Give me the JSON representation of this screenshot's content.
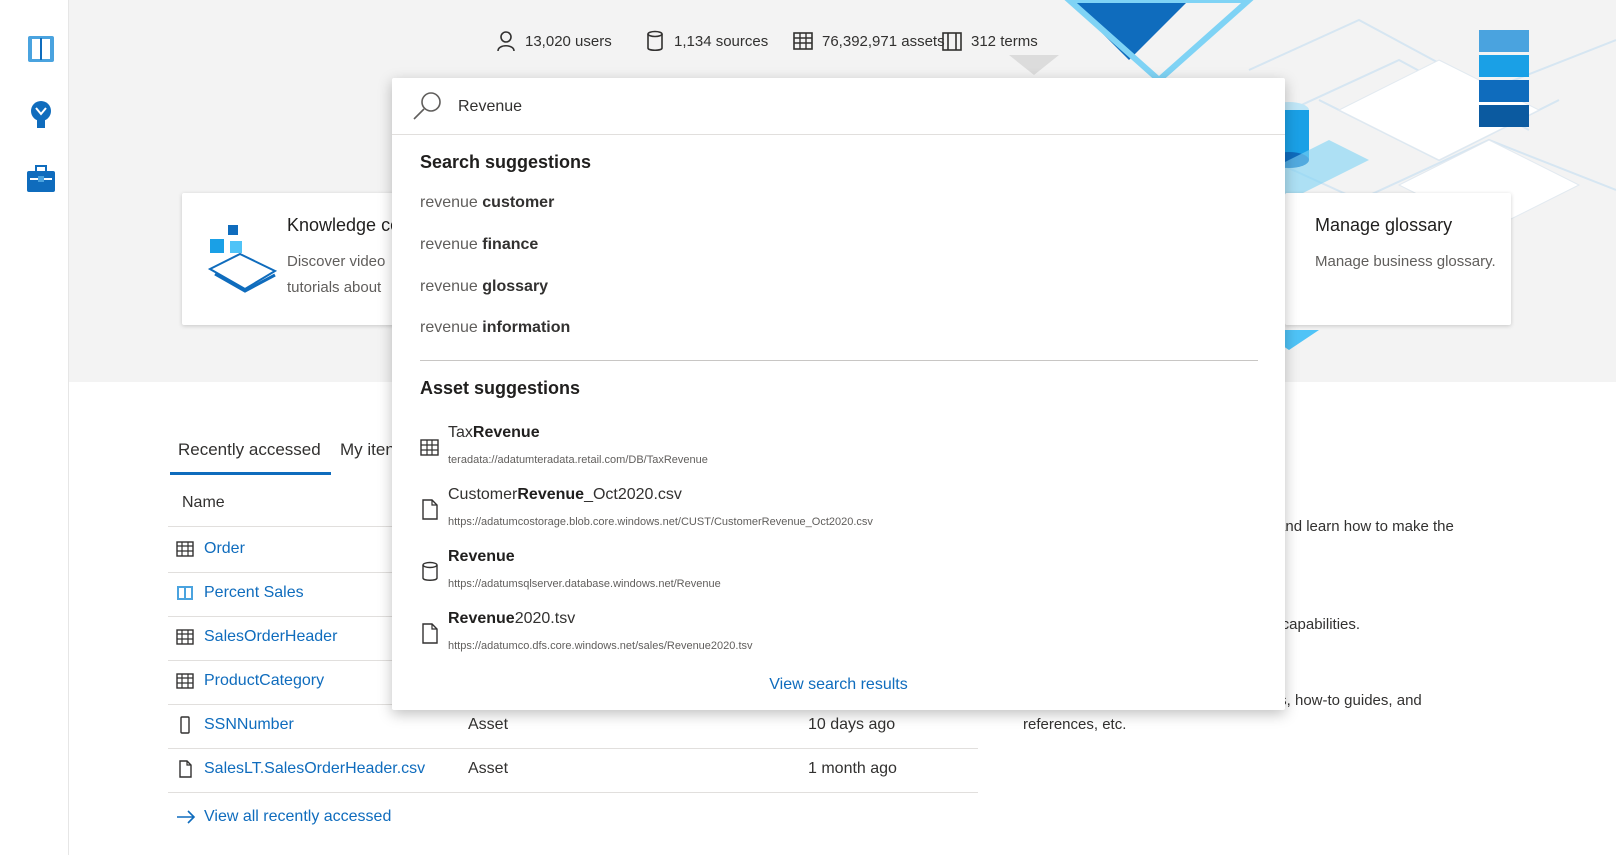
{
  "stats": [
    {
      "icon": "user-icon",
      "label": "13,020 users"
    },
    {
      "icon": "database-icon",
      "label": "1,134 sources"
    },
    {
      "icon": "table-icon",
      "label": "76,392,971 assets"
    },
    {
      "icon": "book-icon",
      "label": "312 terms"
    }
  ],
  "cards": {
    "knowledge": {
      "title": "Knowledge ce",
      "line1": "Discover video",
      "line2": "tutorials about"
    },
    "glossary": {
      "title": "Manage glossary",
      "desc": "Manage business glossary."
    }
  },
  "tabs": [
    {
      "label": "Recently accessed",
      "active": true
    },
    {
      "label": "My iten",
      "active": false
    }
  ],
  "table": {
    "header_name": "Name",
    "rows": [
      {
        "icon": "table-icon",
        "name": "Order",
        "type": "",
        "when": ""
      },
      {
        "icon": "book-icon",
        "name": "Percent Sales",
        "type": "",
        "when": ""
      },
      {
        "icon": "table-icon",
        "name": "SalesOrderHeader",
        "type": "",
        "when": ""
      },
      {
        "icon": "table-icon",
        "name": "ProductCategory",
        "type": "",
        "when": ""
      },
      {
        "icon": "phone-icon",
        "name": "SSNNumber",
        "type": "Asset",
        "when": "10 days ago"
      },
      {
        "icon": "file-icon",
        "name": "SalesLT.SalesOrderHeader.csv",
        "type": "Asset",
        "when": "1 month ago"
      }
    ],
    "view_all": "View all recently accessed"
  },
  "right_texts": {
    "t1": "' and learn how to make the",
    "t2": "v capabilities.",
    "t3": "rts, how-to guides, and",
    "t4": "references, etc."
  },
  "search": {
    "value": "Revenue",
    "suggestions_title": "Search suggestions",
    "suggestions": [
      {
        "prefix": "revenue ",
        "bold": "customer"
      },
      {
        "prefix": "revenue ",
        "bold": "finance"
      },
      {
        "prefix": "revenue ",
        "bold": "glossary"
      },
      {
        "prefix": "revenue ",
        "bold": "information"
      }
    ],
    "assets_title": "Asset suggestions",
    "assets": [
      {
        "icon": "table-icon",
        "pre": "Tax",
        "bold": "Revenue",
        "post": "",
        "url": "teradata://adatumteradata.retail.com/DB/TaxRevenue"
      },
      {
        "icon": "file-icon",
        "pre": "Customer",
        "bold": "Revenue",
        "post": "_Oct2020.csv",
        "url": "https://adatumcostorage.blob.core.windows.net/CUST/CustomerRevenue_Oct2020.csv"
      },
      {
        "icon": "database-icon",
        "pre": "",
        "bold": "Revenue",
        "post": "",
        "url": "https://adatumsqlserver.database.windows.net/Revenue"
      },
      {
        "icon": "file-icon",
        "pre": "",
        "bold": "Revenue",
        "post": "2020.tsv",
        "url": "https://adatumco.dfs.core.windows.net/sales/Revenue2020.tsv"
      }
    ],
    "view_results": "View search results"
  },
  "colors": {
    "accent": "#0f6cbd",
    "hero_bg": "#f3f3f3"
  }
}
